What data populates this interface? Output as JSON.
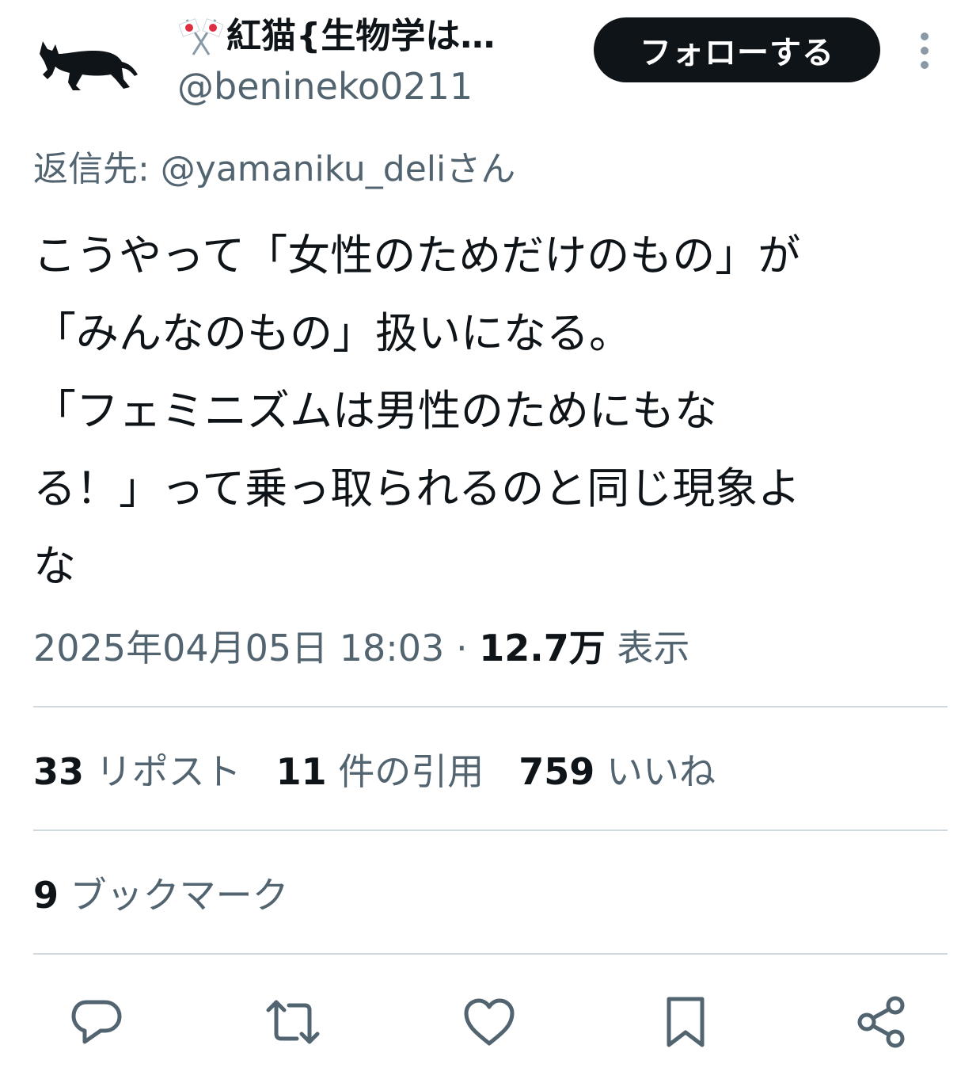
{
  "header": {
    "display_name": "紅猫{生物学は…",
    "handle": "@benineko0211",
    "follow_label": "フォローする"
  },
  "reply_to": "返信先: @yamaniku_deliさん",
  "tweet": {
    "lines": [
      "こうやって「女性のためだけのもの」が",
      "「みんなのもの」扱いになる。",
      "「フェミニズムは男性のためにもな",
      "る！」って乗っ取られるのと同じ現象よ",
      "な"
    ]
  },
  "meta": {
    "timestamp": "2025年04月05日 18:03",
    "separator": " · ",
    "views_count": "12.7万",
    "views_label": " 表示"
  },
  "stats": {
    "reposts_count": "33",
    "reposts_label": "リポスト",
    "quotes_count": "11",
    "quotes_label": "件の引用",
    "likes_count": "759",
    "likes_label": "いいね",
    "bookmarks_count": "9",
    "bookmarks_label": "ブックマーク"
  },
  "icons": {
    "avatar": "black-cat-icon",
    "flag": "crossed-japan-flags-icon",
    "more": "vertical-dots-icon",
    "reply": "reply-icon",
    "repost": "repost-icon",
    "like": "heart-icon",
    "bookmark": "bookmark-icon",
    "share": "share-icon"
  },
  "colors": {
    "text_primary": "#0f1419",
    "text_secondary": "#536471",
    "divider": "#cfd9de",
    "button_bg": "#0f1419",
    "button_text": "#ffffff"
  }
}
